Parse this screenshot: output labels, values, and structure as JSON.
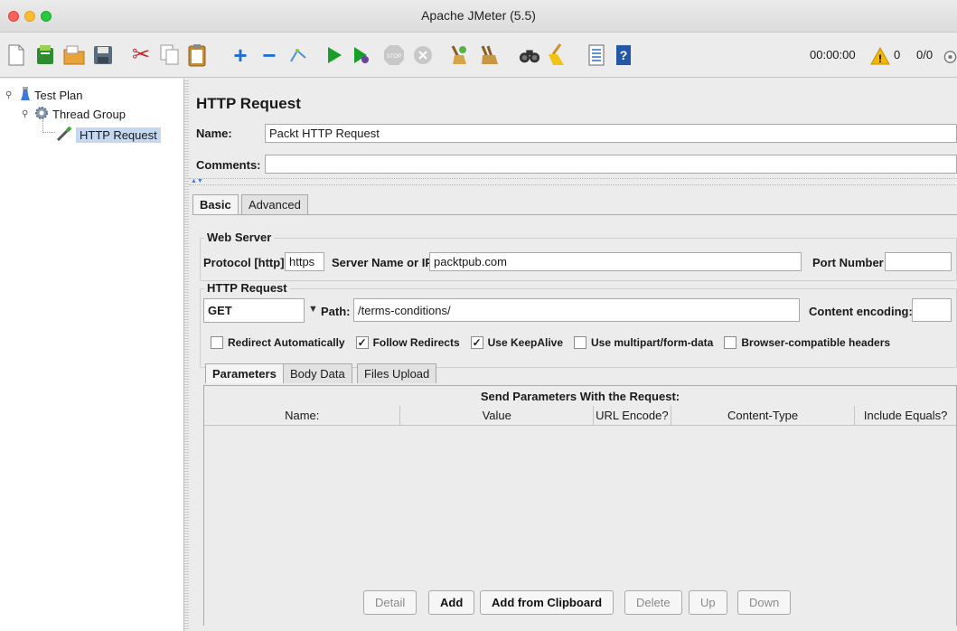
{
  "window": {
    "title": "Apache JMeter (5.5)"
  },
  "toolbar": {
    "timer": "00:00:00",
    "warning_count": "0",
    "thread_counts": "0/0",
    "icons": [
      "new-icon",
      "templates-icon",
      "open-icon",
      "save-icon",
      "cut-icon",
      "copy-icon",
      "paste-icon",
      "expand-icon",
      "collapse-icon",
      "toggle-icon",
      "start-icon",
      "start-no-pauses-icon",
      "stop-icon",
      "shutdown-icon",
      "clear-icon",
      "clear-all-icon",
      "search-icon",
      "reset-search-icon",
      "function-helper-icon",
      "help-icon",
      "log-viewer-icon"
    ]
  },
  "tree": {
    "items": [
      {
        "label": "Test Plan"
      },
      {
        "label": "Thread Group"
      },
      {
        "label": "HTTP Request"
      }
    ]
  },
  "panel": {
    "title": "HTTP Request",
    "name_label": "Name:",
    "name_value": "Packt HTTP Request",
    "comments_label": "Comments:",
    "comments_value": "",
    "tabs": [
      {
        "label": "Basic"
      },
      {
        "label": "Advanced"
      }
    ],
    "web_server": {
      "title": "Web Server",
      "protocol_label": "Protocol [http]:",
      "protocol_value": "https",
      "server_label": "Server Name or IP:",
      "server_value": "packtpub.com",
      "port_label": "Port Number:",
      "port_value": ""
    },
    "http_request": {
      "title": "HTTP Request",
      "method": "GET",
      "path_label": "Path:",
      "path_value": "/terms-conditions/",
      "encoding_label": "Content encoding:",
      "encoding_value": ""
    },
    "checkboxes": [
      {
        "label": "Redirect Automatically",
        "checked": false
      },
      {
        "label": "Follow Redirects",
        "checked": true
      },
      {
        "label": "Use KeepAlive",
        "checked": true
      },
      {
        "label": "Use multipart/form-data",
        "checked": false
      },
      {
        "label": "Browser-compatible headers",
        "checked": false
      }
    ],
    "subtabs": [
      {
        "label": "Parameters"
      },
      {
        "label": "Body Data"
      },
      {
        "label": "Files Upload"
      }
    ],
    "params": {
      "heading": "Send Parameters With the Request:",
      "columns": [
        "Name:",
        "Value",
        "URL Encode?",
        "Content-Type",
        "Include Equals?"
      ]
    },
    "buttons": {
      "detail": "Detail",
      "add": "Add",
      "add_clipboard": "Add from Clipboard",
      "delete": "Delete",
      "up": "Up",
      "down": "Down"
    }
  },
  "colors": {
    "selection": "#c5d8ef",
    "start_green": "#1a9e2a",
    "warning": "#f2b705"
  }
}
